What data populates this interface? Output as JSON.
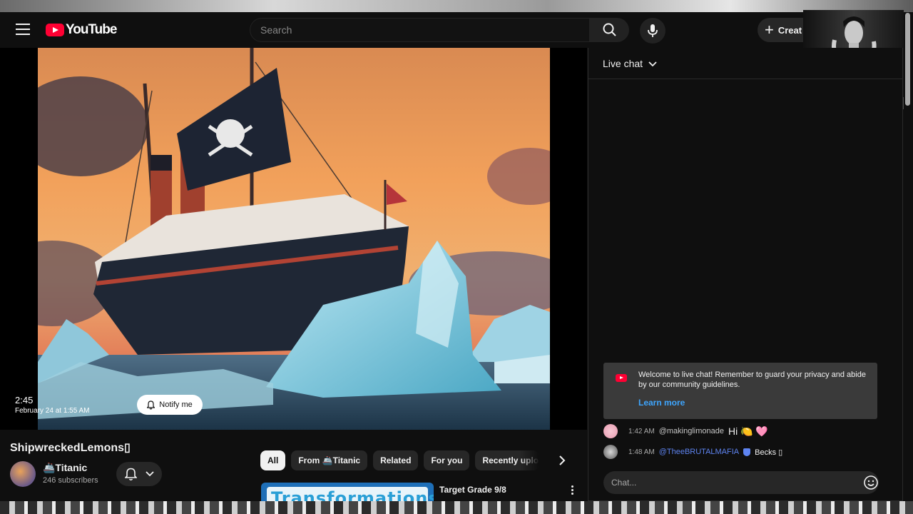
{
  "masthead": {
    "logo_text": "YouTube",
    "search_placeholder": "Search",
    "create_label": "Creat",
    "icons": [
      "menu-icon",
      "search-icon",
      "mic-icon",
      "plus-icon"
    ]
  },
  "player": {
    "time": "2:45",
    "scheduled": "February 24 at 1:55 AM",
    "notify_label": "Notify me"
  },
  "video": {
    "title": "ShipwreckedLemons▯",
    "channel_name": "🚢Titanic",
    "subscribers": "246 subscribers"
  },
  "chips": [
    "All",
    "From 🚢Titanic",
    "Related",
    "For you",
    "Recently uploaded"
  ],
  "recommended": [
    {
      "thumb_text": "Transformations",
      "title": "Target Grade 9/8"
    }
  ],
  "chat": {
    "header": "Live chat",
    "welcome_text": "Welcome to live chat! Remember to guard your privacy and abide by our community guidelines.",
    "learn_more": "Learn more",
    "messages": [
      {
        "time": "1:42 AM",
        "author": "@makinglimonade",
        "text": "Hi 🍋 🩷"
      },
      {
        "time": "1:48 AM",
        "author": "@TheeBRUTALMAFIA",
        "text": "Becks ▯"
      }
    ],
    "input_placeholder": "Chat...",
    "colors": {
      "mod_author": "#5e84f1",
      "link": "#3ea6ff",
      "brand": "#ff0033"
    }
  }
}
